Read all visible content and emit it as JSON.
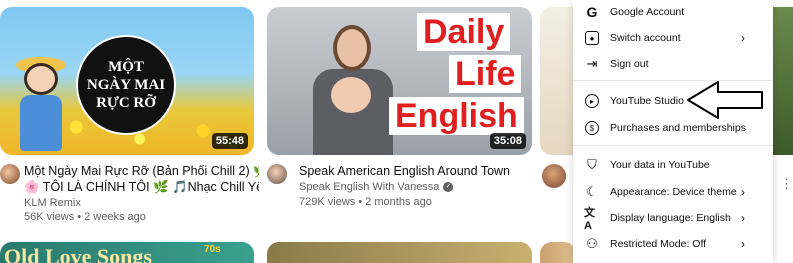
{
  "videos": [
    {
      "thumb_title": "MỘT NGÀY MAI RỰC RỠ",
      "duration": "55:48",
      "title_line1": "Một Ngày Mai Rực Rỡ (Bản Phối Chill 2) 🌿",
      "title_line2": "🌸 TÔI LÀ CHÍNH TÔI 🌿 🎵Nhạc Chill Yêu ...",
      "channel": "KLM Remix",
      "meta": "56K views • 2 weeks ago"
    },
    {
      "thumb_words": [
        "Daily",
        "Life",
        "English"
      ],
      "duration": "35:08",
      "title_line1": "Speak American English Around Town",
      "channel": "Speak English With Vanessa",
      "meta": "729K views • 2 months ago"
    }
  ],
  "bottom_row": {
    "thumb1_text": "Old Love Songs",
    "thumb1_badge": "70s"
  },
  "menu": {
    "items": [
      {
        "label": "Google Account",
        "icon": "google-g-icon"
      },
      {
        "label": "Switch account",
        "icon": "switch-account-icon",
        "chevron": true
      },
      {
        "label": "Sign out",
        "icon": "sign-out-icon"
      },
      {
        "label": "YouTube Studio",
        "icon": "youtube-studio-icon"
      },
      {
        "label": "Purchases and memberships",
        "icon": "dollar-icon"
      },
      {
        "label": "Your data in YouTube",
        "icon": "shield-icon"
      },
      {
        "label": "Appearance: Device theme",
        "icon": "moon-icon",
        "chevron": true
      },
      {
        "label": "Display language: English",
        "icon": "translate-icon",
        "chevron": true
      },
      {
        "label": "Restricted Mode: Off",
        "icon": "restricted-mode-icon",
        "chevron": true
      }
    ]
  },
  "colors": {
    "accent_red": "#e02020",
    "text_primary": "#0f0f0f",
    "text_secondary": "#606060"
  }
}
